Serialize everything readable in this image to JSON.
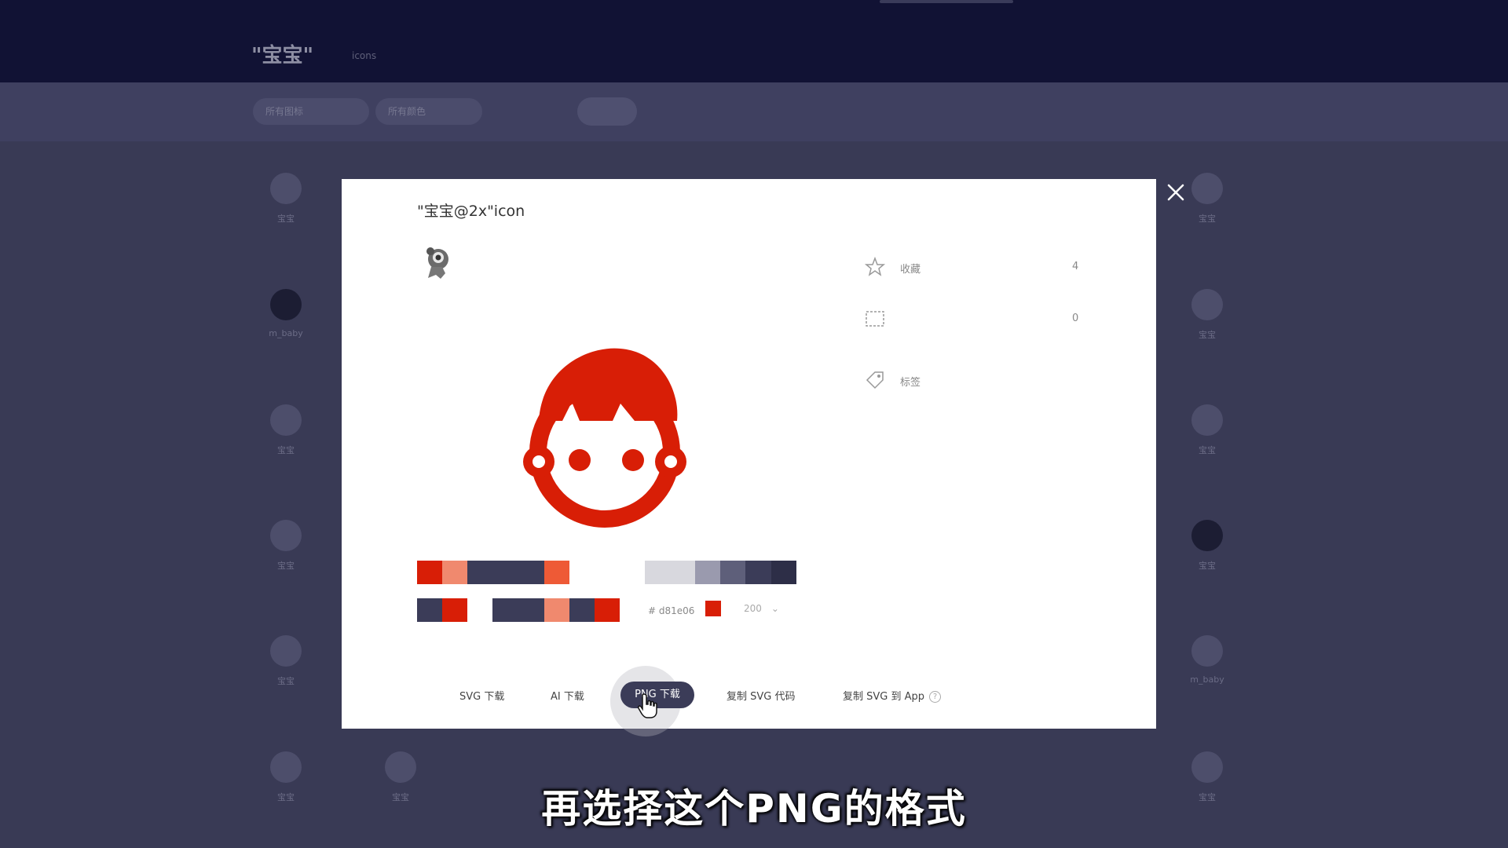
{
  "background": {
    "page_title": "\"宝宝\"",
    "page_subtitle": "icons",
    "filters": [
      "所有图标",
      "所有颜色"
    ],
    "icon_labels": {
      "r1c1": "宝宝",
      "r1c9": "宝宝",
      "r2c1": "m_baby",
      "r2c9": "宝宝",
      "r3c1": "宝宝",
      "r3c9": "宝宝",
      "r4c1": "宝宝",
      "r4c9": "宝宝",
      "r5c1": "宝宝",
      "r5c9": "m_baby",
      "r6c1": "宝宝",
      "r6c2": "宝宝",
      "r6c9": "宝宝"
    }
  },
  "modal": {
    "title": "\"宝宝@2x\"icon",
    "title_link": "",
    "author_label": "",
    "author_name": "",
    "date_label": "",
    "date_value": "",
    "stats": {
      "favorite_label": "收藏",
      "favorite_count": "4",
      "collection_label": "",
      "collection_count": "0",
      "collection_note": "",
      "tag_label": "标签",
      "tag_note": ""
    },
    "color": {
      "hex_label": "# d81e06",
      "hex_value": "#d81e06",
      "size_value": "200",
      "size_chevron": "⌄"
    },
    "actions": {
      "svg_download": "SVG 下载",
      "ai_download": "AI 下载",
      "png_download": "PNG 下载",
      "copy_svg_code": "复制 SVG 代码",
      "copy_svg_app": "复制 SVG 到 App",
      "help": "?",
      "download_copyright": ""
    },
    "icon_color": "#d81e06",
    "close_icon": "close-icon"
  },
  "subtitle": "再选择这个PNG的格式"
}
